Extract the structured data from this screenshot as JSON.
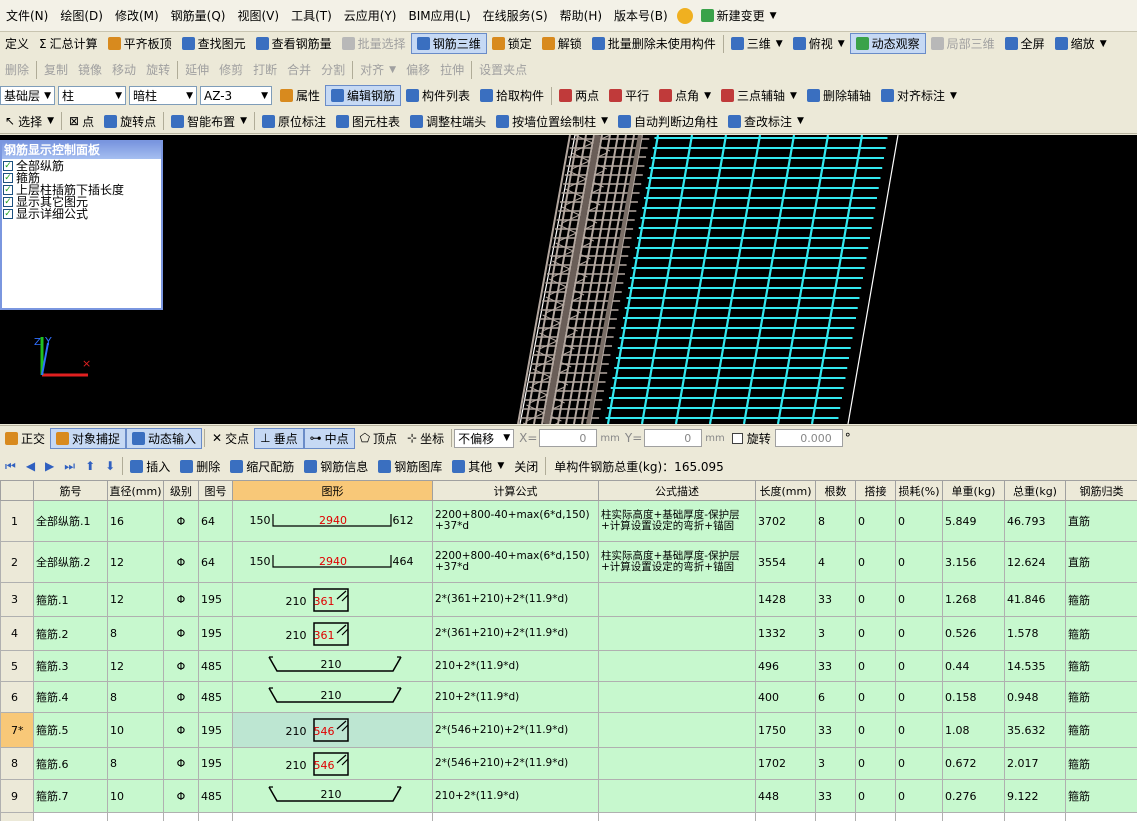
{
  "menu": [
    "文件(N)",
    "绘图(D)",
    "修改(M)",
    "钢筋量(Q)",
    "视图(V)",
    "工具(T)",
    "云应用(Y)",
    "BIM应用(L)",
    "在线服务(S)",
    "帮助(H)",
    "版本号(B)",
    "新建变更"
  ],
  "toolbar1": [
    "定义",
    "汇总计算",
    "平齐板顶",
    "查找图元",
    "查看钢筋量",
    "批量选择",
    "钢筋三维",
    "锁定",
    "解锁",
    "批量删除未使用构件",
    "三维",
    "俯视",
    "动态观察",
    "局部三维",
    "全屏",
    "缩放"
  ],
  "toolbar2": [
    "删除",
    "复制",
    "镜像",
    "移动",
    "旋转",
    "延伸",
    "修剪",
    "打断",
    "合并",
    "分割",
    "对齐",
    "偏移",
    "拉伸",
    "设置夹点"
  ],
  "toolbar3": {
    "floor": "基础层",
    "category": "柱",
    "type": "暗柱",
    "component": "AZ-3",
    "buttons": [
      "属性",
      "编辑钢筋",
      "构件列表",
      "拾取构件",
      "两点",
      "平行",
      "点角",
      "三点辅轴",
      "删除辅轴",
      "对齐标注"
    ]
  },
  "toolbar4": [
    "选择",
    "点",
    "旋转点",
    "智能布置",
    "原位标注",
    "图元柱表",
    "调整柱端头",
    "按墙位置绘制柱",
    "自动判断边角柱",
    "查改标注"
  ],
  "control_panel": {
    "title": "钢筋显示控制面板",
    "items": [
      "全部纵筋",
      "箍筋",
      "上层柱插筋下插长度",
      "显示其它图元",
      "显示详细公式"
    ]
  },
  "snapbar": {
    "buttons": [
      "正交",
      "对象捕捉",
      "动态输入",
      "交点",
      "垂点",
      "中点",
      "顶点",
      "坐标"
    ],
    "offset_mode": "不偏移",
    "x_label": "X=",
    "x_value": "0",
    "y_label": "Y=",
    "y_value": "0",
    "unit": "mm",
    "rotate_label": "旋转",
    "rotate_value": "0.000",
    "degree": "°"
  },
  "grid_toolbar": {
    "buttons": [
      "插入",
      "删除",
      "缩尺配筋",
      "钢筋信息",
      "钢筋图库",
      "其他",
      "关闭"
    ],
    "total_label": "单构件钢筋总重(kg)：165.095"
  },
  "table": {
    "columns": [
      "",
      "筋号",
      "直径(mm)",
      "级别",
      "图号",
      "图形",
      "计算公式",
      "公式描述",
      "长度(mm)",
      "根数",
      "搭接",
      "损耗(%)",
      "单重(kg)",
      "总重(kg)",
      "钢筋归类"
    ],
    "rows": [
      {
        "no": "1",
        "name": "全部纵筋.1",
        "dia": "16",
        "grade": "Φ",
        "fig": "64",
        "shape": {
          "kind": "straight",
          "left": "150",
          "mid": "2940",
          "right": "612"
        },
        "formula": "2200+800-40+max(6*d,150)+37*d",
        "desc": "柱实际高度+基础厚度-保护层+计算设置设定的弯折+锚固",
        "length": "3702",
        "count": "8",
        "lap": "0",
        "loss": "0",
        "unit_w": "5.849",
        "total_w": "46.793",
        "cat": "直筋"
      },
      {
        "no": "2",
        "name": "全部纵筋.2",
        "dia": "12",
        "grade": "Φ",
        "fig": "64",
        "shape": {
          "kind": "straight",
          "left": "150",
          "mid": "2940",
          "right": "464"
        },
        "formula": "2200+800-40+max(6*d,150)+37*d",
        "desc": "柱实际高度+基础厚度-保护层+计算设置设定的弯折+锚固",
        "length": "3554",
        "count": "4",
        "lap": "0",
        "loss": "0",
        "unit_w": "3.156",
        "total_w": "12.624",
        "cat": "直筋"
      },
      {
        "no": "3",
        "name": "箍筋.1",
        "dia": "12",
        "grade": "Φ",
        "fig": "195",
        "shape": {
          "kind": "stirrup",
          "left": "210",
          "mid": "361"
        },
        "formula": "2*(361+210)+2*(11.9*d)",
        "desc": "",
        "length": "1428",
        "count": "33",
        "lap": "0",
        "loss": "0",
        "unit_w": "1.268",
        "total_w": "41.846",
        "cat": "箍筋"
      },
      {
        "no": "4",
        "name": "箍筋.2",
        "dia": "8",
        "grade": "Φ",
        "fig": "195",
        "shape": {
          "kind": "stirrup",
          "left": "210",
          "mid": "361"
        },
        "formula": "2*(361+210)+2*(11.9*d)",
        "desc": "",
        "length": "1332",
        "count": "3",
        "lap": "0",
        "loss": "0",
        "unit_w": "0.526",
        "total_w": "1.578",
        "cat": "箍筋"
      },
      {
        "no": "5",
        "name": "箍筋.3",
        "dia": "12",
        "grade": "Φ",
        "fig": "485",
        "shape": {
          "kind": "tie",
          "mid": "210"
        },
        "formula": "210+2*(11.9*d)",
        "desc": "",
        "length": "496",
        "count": "33",
        "lap": "0",
        "loss": "0",
        "unit_w": "0.44",
        "total_w": "14.535",
        "cat": "箍筋"
      },
      {
        "no": "6",
        "name": "箍筋.4",
        "dia": "8",
        "grade": "Φ",
        "fig": "485",
        "shape": {
          "kind": "tie",
          "mid": "210"
        },
        "formula": "210+2*(11.9*d)",
        "desc": "",
        "length": "400",
        "count": "6",
        "lap": "0",
        "loss": "0",
        "unit_w": "0.158",
        "total_w": "0.948",
        "cat": "箍筋"
      },
      {
        "no": "7*",
        "name": "箍筋.5",
        "dia": "10",
        "grade": "Φ",
        "fig": "195",
        "shape": {
          "kind": "stirrup",
          "left": "210",
          "mid": "546"
        },
        "formula": "2*(546+210)+2*(11.9*d)",
        "desc": "",
        "length": "1750",
        "count": "33",
        "lap": "0",
        "loss": "0",
        "unit_w": "1.08",
        "total_w": "35.632",
        "cat": "箍筋"
      },
      {
        "no": "8",
        "name": "箍筋.6",
        "dia": "8",
        "grade": "Φ",
        "fig": "195",
        "shape": {
          "kind": "stirrup",
          "left": "210",
          "mid": "546"
        },
        "formula": "2*(546+210)+2*(11.9*d)",
        "desc": "",
        "length": "1702",
        "count": "3",
        "lap": "0",
        "loss": "0",
        "unit_w": "0.672",
        "total_w": "2.017",
        "cat": "箍筋"
      },
      {
        "no": "9",
        "name": "箍筋.7",
        "dia": "10",
        "grade": "Φ",
        "fig": "485",
        "shape": {
          "kind": "tie",
          "mid": "210"
        },
        "formula": "210+2*(11.9*d)",
        "desc": "",
        "length": "448",
        "count": "33",
        "lap": "0",
        "loss": "0",
        "unit_w": "0.276",
        "total_w": "9.122",
        "cat": "箍筋"
      },
      {
        "no": "10",
        "name": "",
        "dia": "",
        "grade": "",
        "fig": "",
        "shape": {
          "kind": "none"
        },
        "formula": "",
        "desc": "",
        "length": "",
        "count": "",
        "lap": "",
        "loss": "",
        "unit_w": "",
        "total_w": "",
        "cat": ""
      }
    ]
  },
  "colors": {
    "row_bg": "#c7f8ce",
    "header_highlight": "#f8c878",
    "dim_red": "#e00000",
    "rebar_cyan": "#33e8f0",
    "rebar_grey": "#b4a8a0"
  }
}
